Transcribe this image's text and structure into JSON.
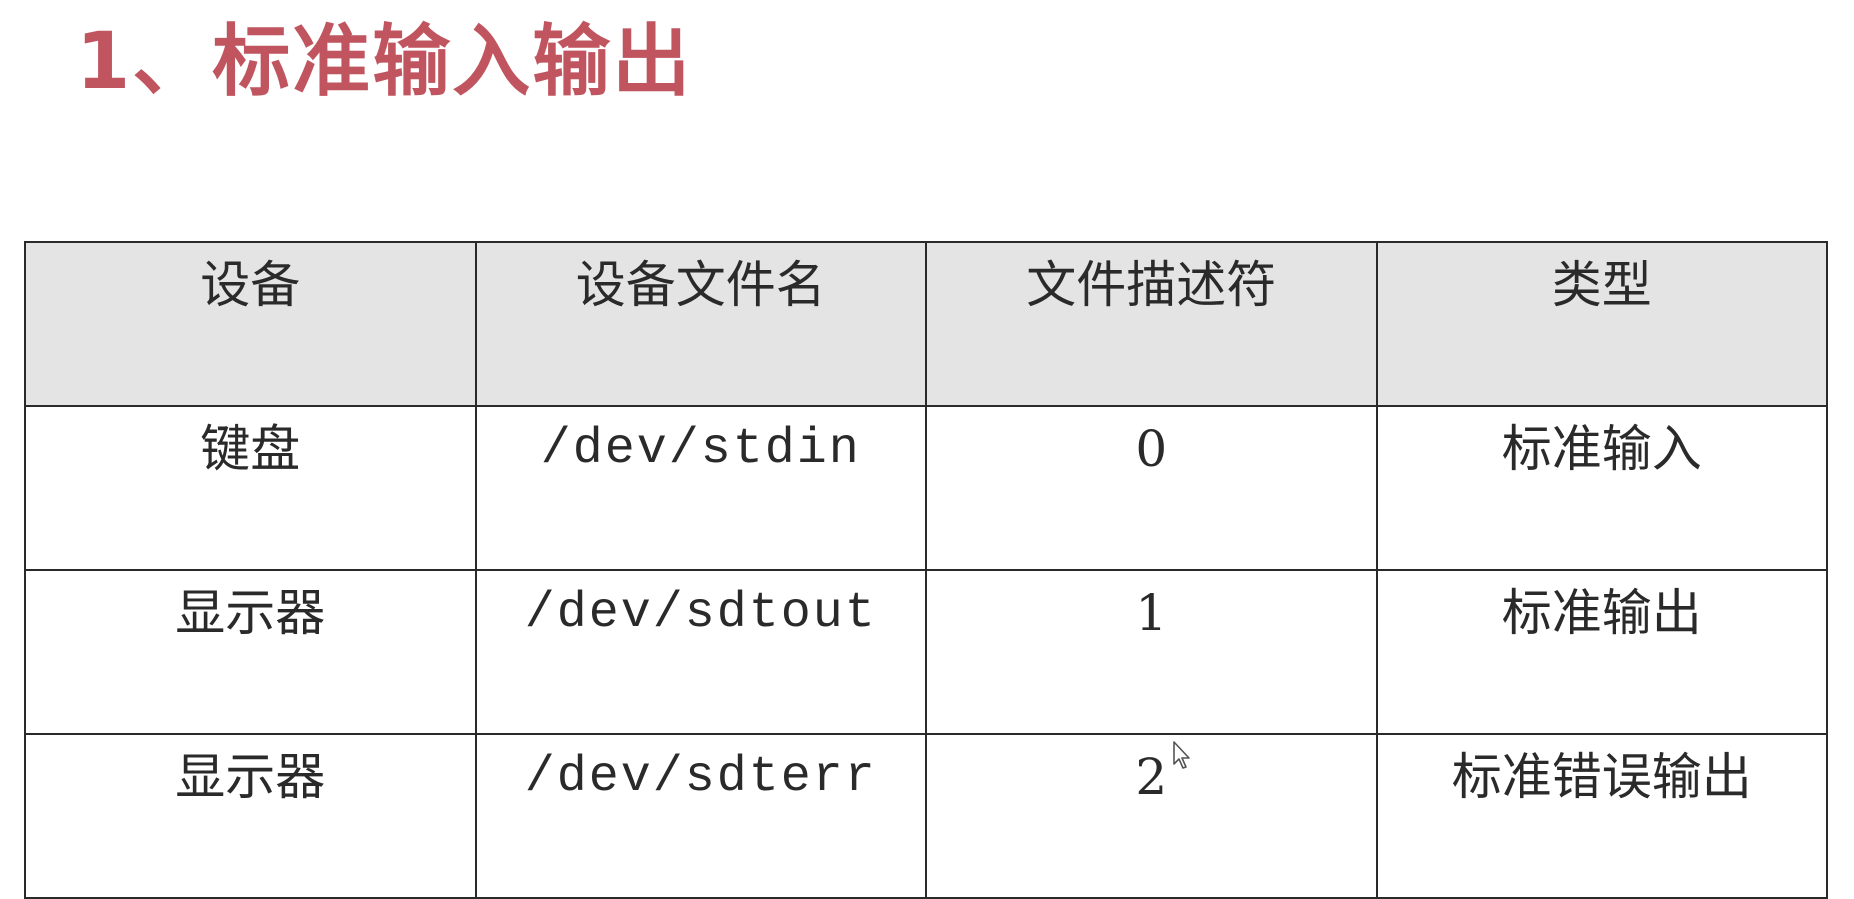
{
  "title": "1、标准输入输出",
  "table": {
    "headers": [
      "设备",
      "设备文件名",
      "文件描述符",
      "类型"
    ],
    "rows": [
      [
        "键盘",
        "/dev/stdin",
        "0",
        "标准输入"
      ],
      [
        "显示器",
        "/dev/sdtout",
        "1",
        "标准输出"
      ],
      [
        "显示器",
        "/dev/sdterr",
        "2",
        "标准错误输出"
      ]
    ]
  },
  "colors": {
    "title": "#c0555f",
    "header_bg": "#e4e4e4",
    "border": "#2a2a2a",
    "text": "#2a2a2a"
  },
  "icons": {
    "cursor": "mouse-pointer-icon"
  }
}
